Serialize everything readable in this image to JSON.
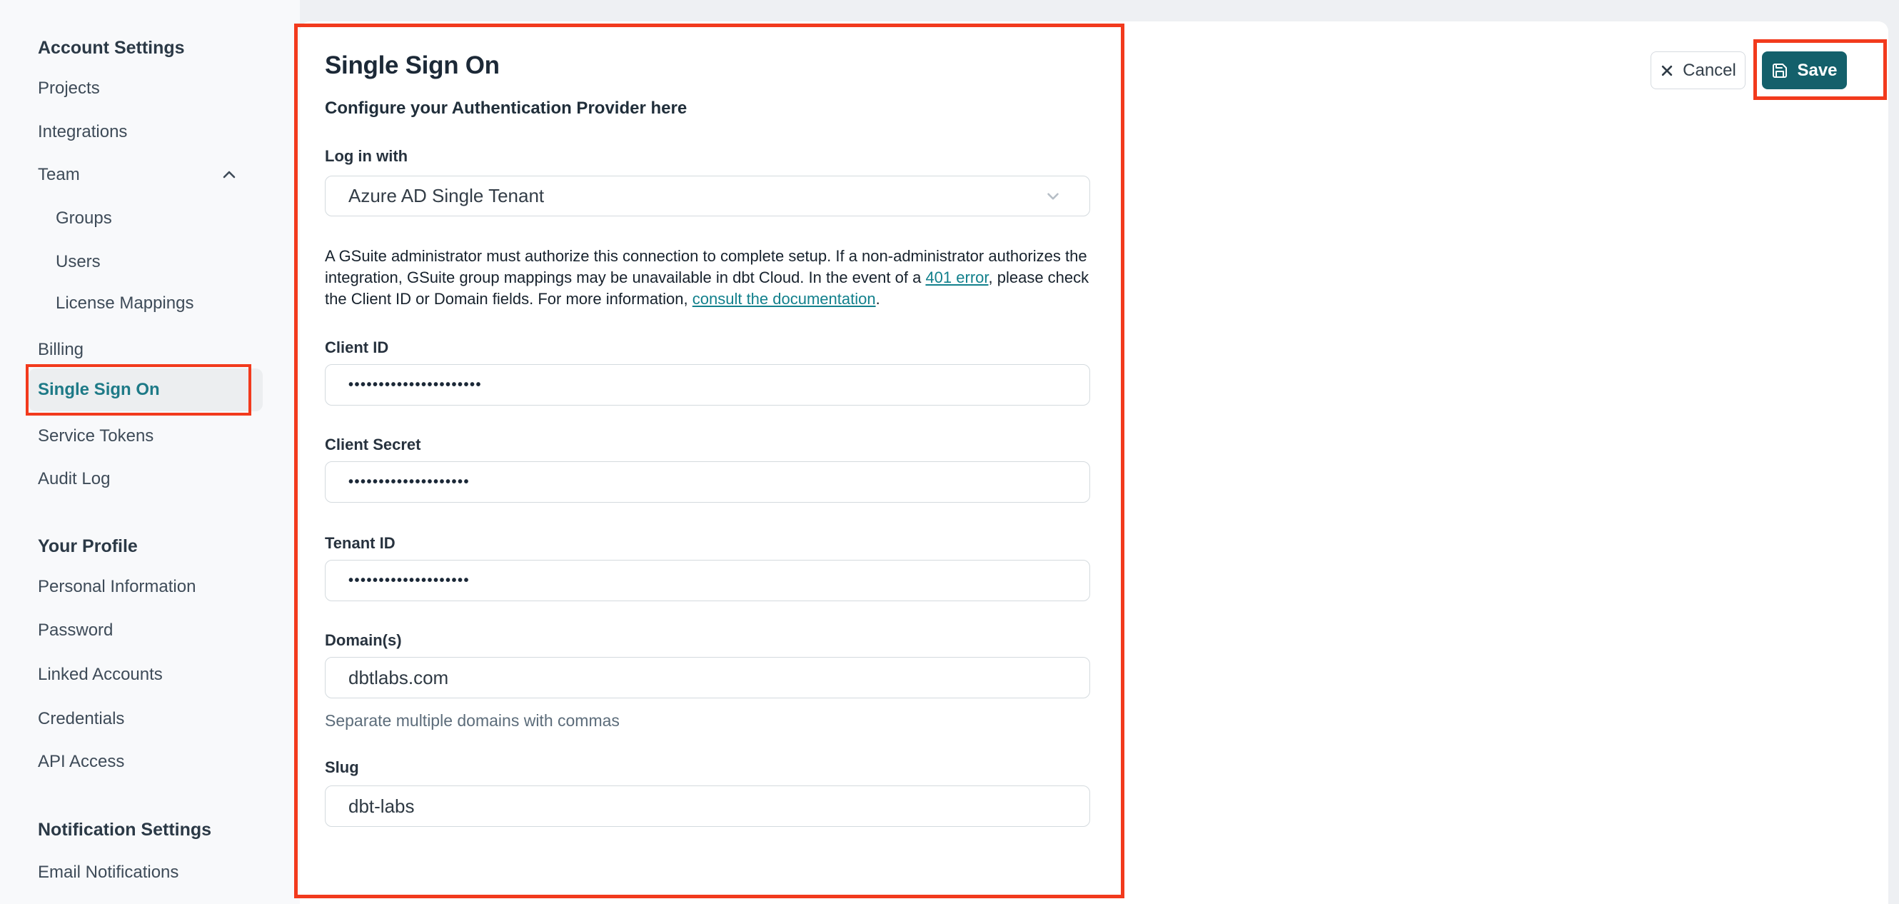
{
  "sidebar": {
    "sections": [
      {
        "title": "Account Settings",
        "items": [
          "Projects",
          "Integrations",
          "Team",
          "Groups",
          "Users",
          "License Mappings",
          "Billing",
          "Single Sign On",
          "Service Tokens",
          "Audit Log"
        ]
      },
      {
        "title": "Your Profile",
        "items": [
          "Personal Information",
          "Password",
          "Linked Accounts",
          "Credentials",
          "API Access"
        ]
      },
      {
        "title": "Notification Settings",
        "items": [
          "Email Notifications"
        ]
      }
    ],
    "active_item": "Single Sign On"
  },
  "main": {
    "title": "Single Sign On",
    "subtitle": "Configure your Authentication Provider here",
    "actions": {
      "cancel": "Cancel",
      "save": "Save"
    },
    "fields": {
      "login_with": {
        "label": "Log in with",
        "value": "Azure AD Single Tenant"
      },
      "client_id": {
        "label": "Client ID",
        "value": "••••••••••••••••••••••"
      },
      "client_secret": {
        "label": "Client Secret",
        "value": "••••••••••••••••••••"
      },
      "tenant_id": {
        "label": "Tenant ID",
        "value": "••••••••••••••••••••"
      },
      "domains": {
        "label": "Domain(s)",
        "value": "dbtlabs.com",
        "helper": "Separate multiple domains with commas"
      },
      "slug": {
        "label": "Slug",
        "value": "dbt-labs"
      }
    },
    "notice": {
      "part1": "A GSuite administrator must authorize this connection to complete setup. If a non-administrator authorizes the integration, GSuite group mappings may be unavailable in dbt Cloud. In the event of a ",
      "link1": "401 error",
      "part2": ", please check the Client ID or Domain fields. For more information, ",
      "link2": "consult the documentation",
      "part3": "."
    }
  },
  "colors": {
    "accent_teal": "#12808c",
    "active_item_teal": "#1e7a87",
    "save_button_bg": "#14606b",
    "annotation_red": "#f23a1d"
  }
}
